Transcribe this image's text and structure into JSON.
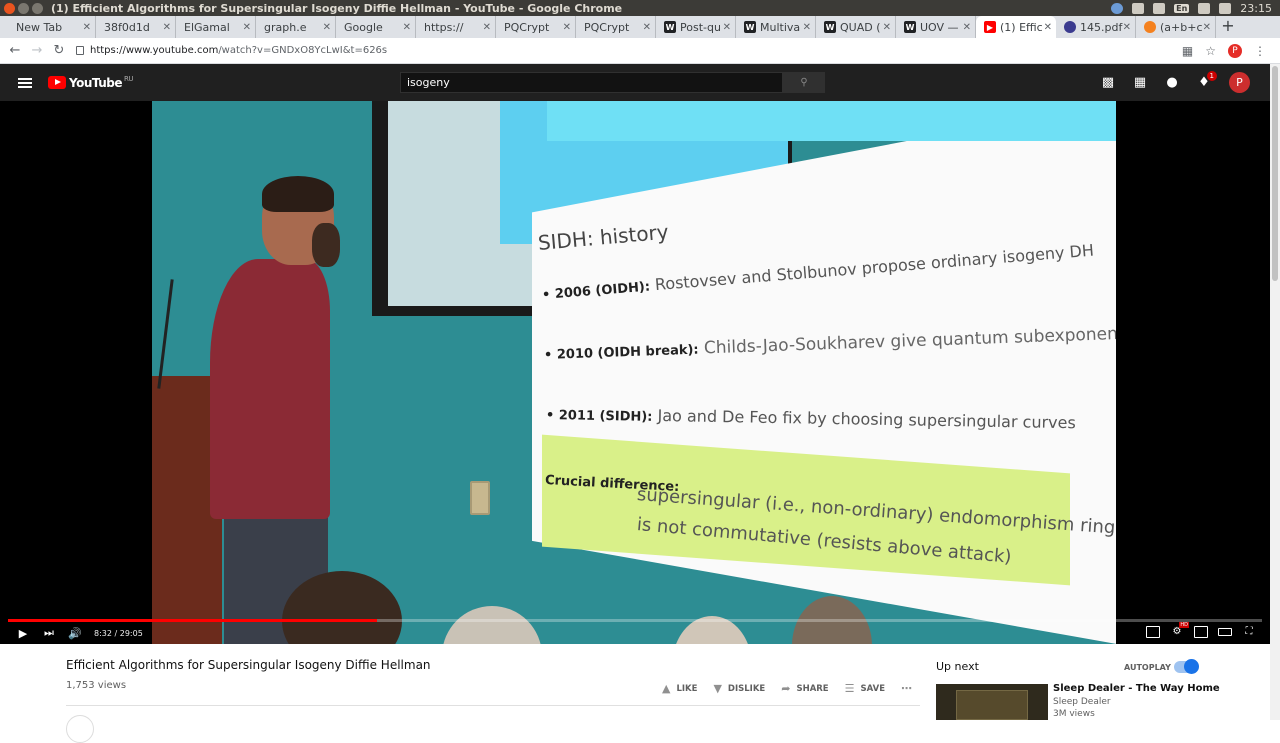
{
  "os": {
    "window_title": "(1) Efficient Algorithms for Supersingular Isogeny Diffie Hellman - YouTube - Google Chrome",
    "lang": "En",
    "time": "23:15"
  },
  "tabs": [
    {
      "title": "New Tab",
      "favicon": "blank",
      "color": "#dee1e6"
    },
    {
      "title": "38f0d1d",
      "favicon": "blank",
      "color": "#dee1e6"
    },
    {
      "title": "ElGamal",
      "favicon": "blank",
      "color": "#dee1e6"
    },
    {
      "title": "graph.e",
      "favicon": "blank",
      "color": "#dee1e6"
    },
    {
      "title": "Google",
      "favicon": "blank",
      "color": "#dee1e6"
    },
    {
      "title": "https://",
      "favicon": "blank",
      "color": "#dee1e6"
    },
    {
      "title": "PQCrypt",
      "favicon": "blank",
      "color": "#dee1e6"
    },
    {
      "title": "PQCrypt",
      "favicon": "blank",
      "color": "#dee1e6"
    },
    {
      "title": "Post-qu",
      "favicon": "W",
      "color": "#202124"
    },
    {
      "title": "Multiva",
      "favicon": "W",
      "color": "#202124"
    },
    {
      "title": "QUAD (",
      "favicon": "W",
      "color": "#202124"
    },
    {
      "title": "UOV —",
      "favicon": "W",
      "color": "#202124"
    },
    {
      "title": "(1) Effic",
      "favicon": "youtube",
      "color": "#ff0000",
      "active": true
    },
    {
      "title": "145.pdf",
      "favicon": "circle",
      "color": "#3b3b8f"
    },
    {
      "title": "(a+b+c+",
      "favicon": "gear",
      "color": "#f4811f"
    }
  ],
  "address": {
    "url_host": "https://www.youtube.com",
    "url_rest": "/watch?v=GNDxO8YcLwI&t=626s",
    "profile_initial": "P"
  },
  "yt_header": {
    "logo_text": "YouTube",
    "region": "RU",
    "search_value": "isogeny",
    "notification_count": "1",
    "avatar_initial": "P"
  },
  "slide": {
    "title": "SIDH: history",
    "bullets": [
      {
        "label": "• 2006 (OIDH):",
        "text": "Rostovsev and Stolbunov propose ordinary isogeny DH"
      },
      {
        "label": "• 2010 (OIDH break):",
        "text": "Childs-Jao-Soukharev give quantum subexponential alg."
      },
      {
        "label": "• 2011 (SIDH):",
        "text": "Jao and De Feo fix by choosing supersingular curves"
      }
    ],
    "crucial_label": "Crucial difference:",
    "crucial_line1": "supersingular (i.e., non-ordinary) endomorphism ring",
    "crucial_line2": "is not commutative (resists above attack)"
  },
  "player": {
    "time": "8:32 / 29:05",
    "progress": 0.294,
    "accent": "#ff0000",
    "hd_label": "HD"
  },
  "video_info": {
    "title": "Efficient Algorithms for Supersingular Isogeny Diffie Hellman",
    "views": "1,753 views",
    "like": "LIKE",
    "dislike": "DISLIKE",
    "share": "SHARE",
    "save": "SAVE"
  },
  "sidebar": {
    "up_next": "Up next",
    "autoplay": "AUTOPLAY",
    "autoplay_on": true,
    "next_title": "Sleep Dealer - The Way Home",
    "next_channel": "Sleep Dealer",
    "next_views": "3M views"
  }
}
